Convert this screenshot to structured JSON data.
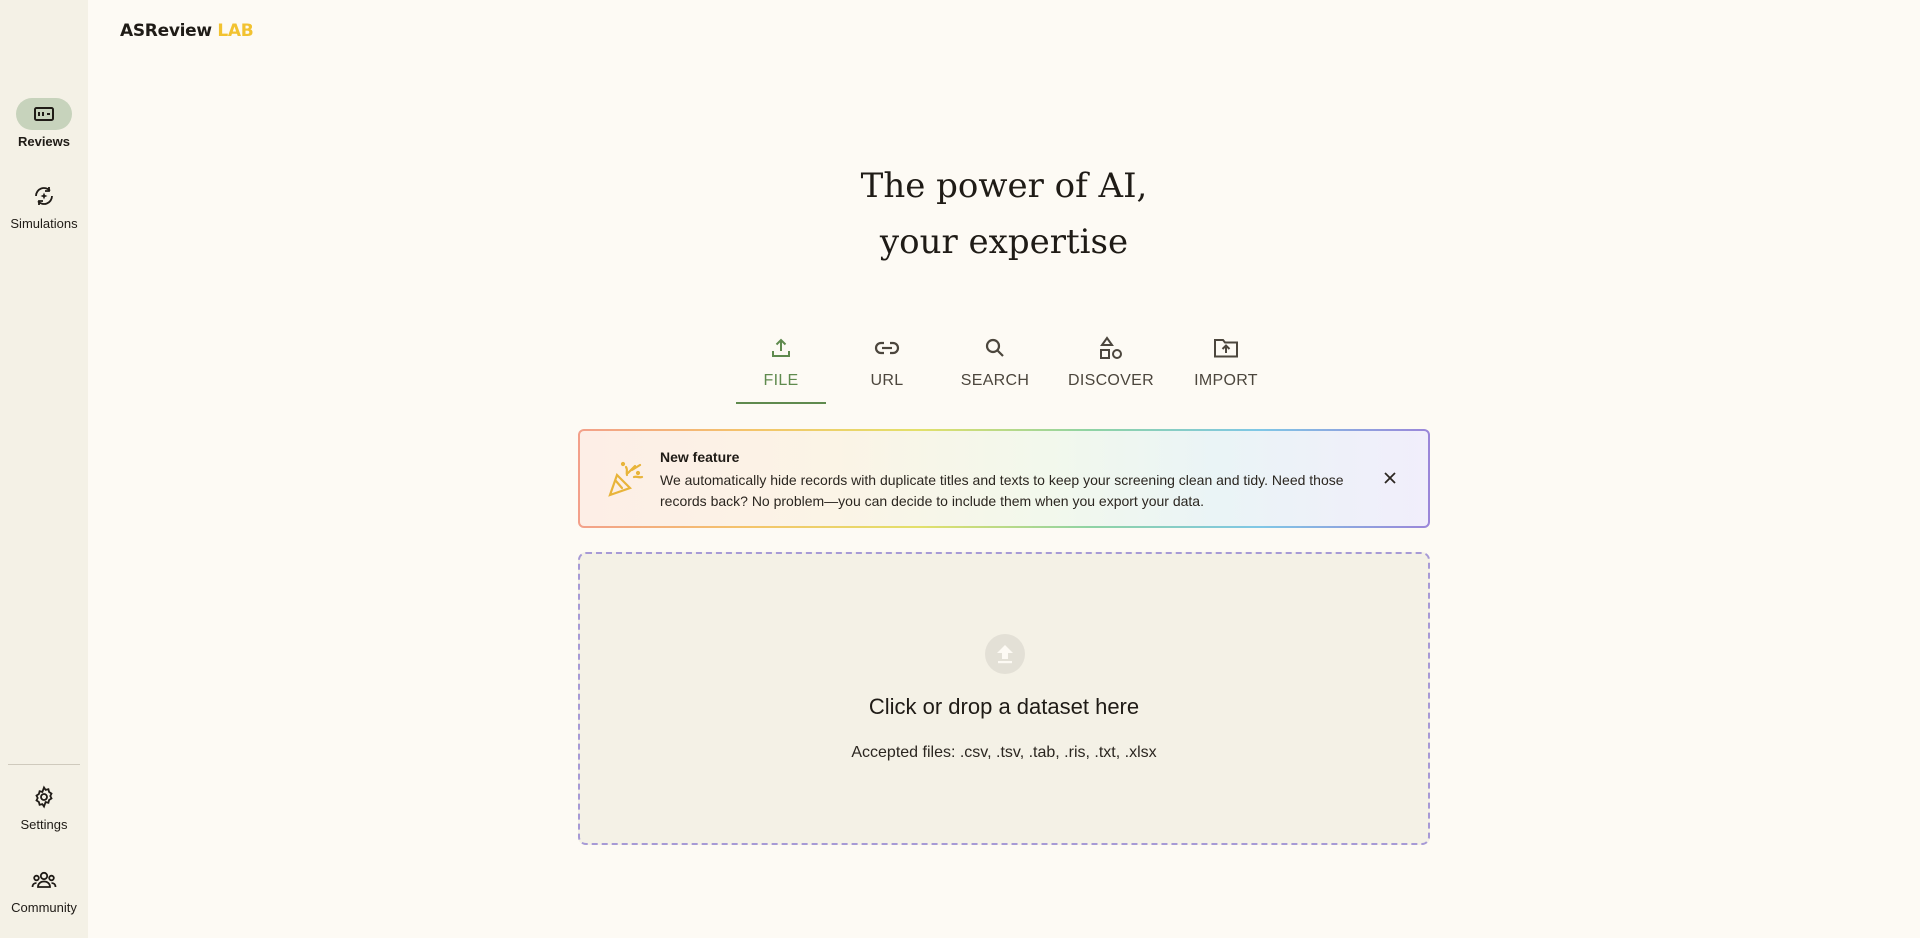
{
  "logo": {
    "brand": "ASReview",
    "lab": "LAB"
  },
  "sidebar": {
    "items": [
      {
        "label": "Reviews",
        "icon": "reviews-icon",
        "active": true
      },
      {
        "label": "Simulations",
        "icon": "simulations-icon",
        "active": false
      },
      {
        "label": "Settings",
        "icon": "gear-icon",
        "active": false
      },
      {
        "label": "Community",
        "icon": "community-icon",
        "active": false
      }
    ]
  },
  "headline": {
    "line1": "The power of AI,",
    "line2": "your expertise"
  },
  "tabs": [
    {
      "label": "FILE",
      "icon": "upload-icon",
      "active": true
    },
    {
      "label": "URL",
      "icon": "link-icon",
      "active": false
    },
    {
      "label": "SEARCH",
      "icon": "search-icon",
      "active": false
    },
    {
      "label": "DISCOVER",
      "icon": "shapes-icon",
      "active": false
    },
    {
      "label": "IMPORT",
      "icon": "folder-upload-icon",
      "active": false
    }
  ],
  "banner": {
    "title": "New feature",
    "text": "We automatically hide records with duplicate titles and texts to keep your screening clean and tidy. Need those records back? No problem—you can decide to include them when you export your data.",
    "icon": "celebration-icon",
    "close_icon": "close-icon"
  },
  "dropzone": {
    "title": "Click or drop a dataset here",
    "subtitle": "Accepted files: .csv, .tsv, .tab, .ris, .txt, .xlsx",
    "icon": "upload-circle-icon"
  },
  "colors": {
    "accent": "#5f8a4e",
    "logo_lab": "#f2c230",
    "sidebar_active": "#c7d3bc",
    "dropzone_border": "#a79ad6"
  }
}
